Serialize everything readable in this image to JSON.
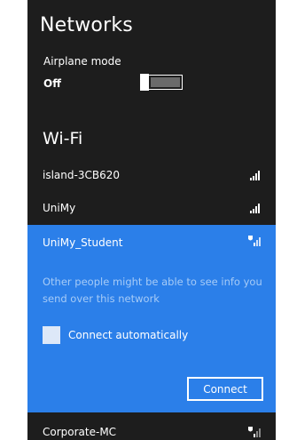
{
  "title": "Networks",
  "airplane": {
    "label": "Airplane mode",
    "state": "Off"
  },
  "wifi": {
    "header": "Wi-Fi",
    "networks": [
      {
        "name": "island-3CB620",
        "signal_icon": "signal-bars-icon",
        "secured": true
      },
      {
        "name": "UniMy",
        "signal_icon": "signal-bars-icon",
        "secured": true
      },
      {
        "name": "UniMy_Student",
        "signal_icon": "signal-shield-icon",
        "secured": false
      },
      {
        "name": "Corporate-MC",
        "signal_icon": "signal-shield-icon",
        "secured": false
      }
    ],
    "selected": {
      "warning": "Other people might be able to see info you send over this network",
      "connect_auto_label": "Connect automatically",
      "connect_auto_checked": false,
      "connect_label": "Connect"
    }
  },
  "colors": {
    "panel_bg": "#1d1d1d",
    "selected_bg": "#2b7fe9",
    "warning_text": "#a6cbf7"
  }
}
